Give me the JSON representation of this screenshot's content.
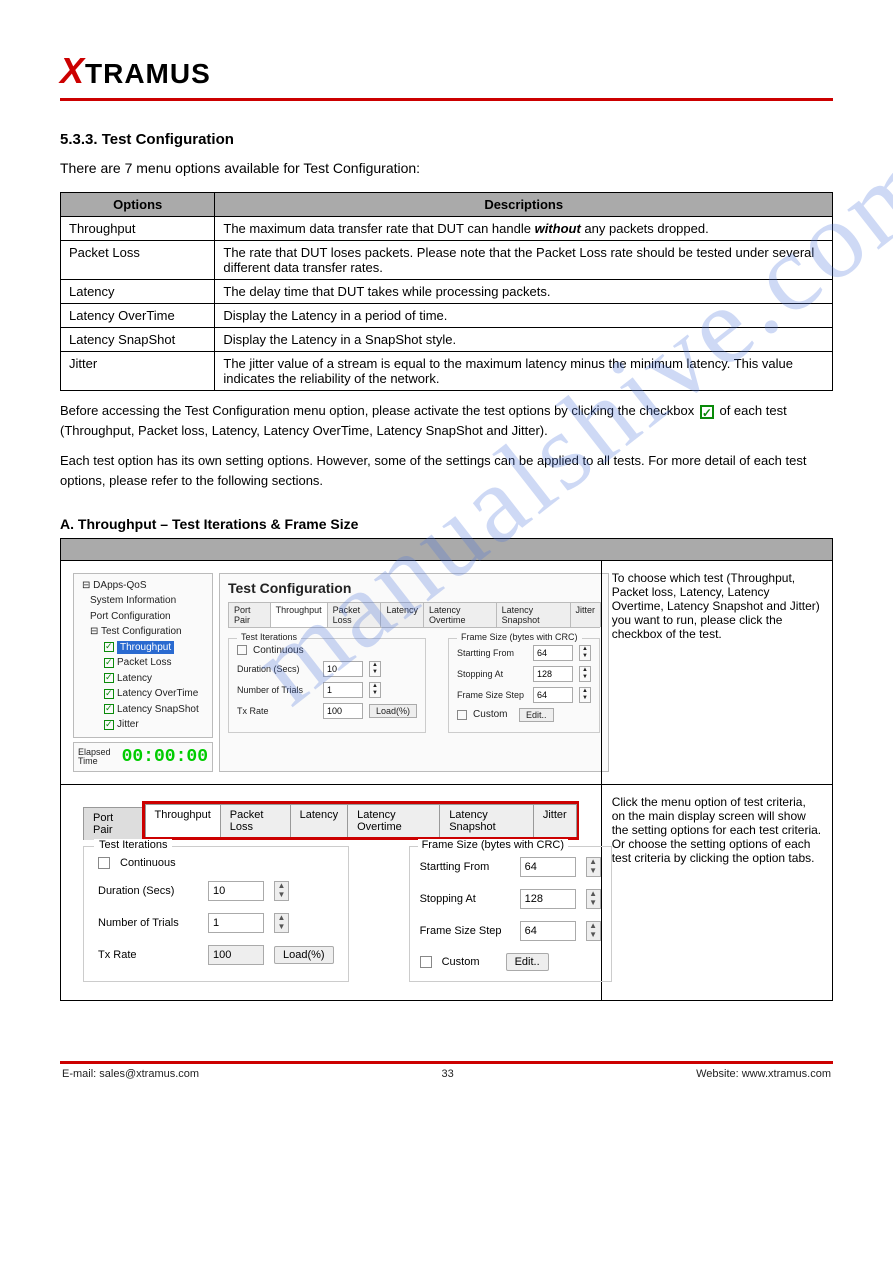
{
  "logo": {
    "x": "X",
    "rest": "TRAMUS"
  },
  "section_heading": "5.3.3. Test Configuration",
  "intro": "There are 7 menu options available for Test Configuration:",
  "def_table": {
    "headers": [
      "Options",
      "Descriptions"
    ],
    "rows": [
      {
        "opt": "Throughput",
        "desc_pre": "The maximum data transfer rate that DUT can handle ",
        "desc_italic": "without",
        "desc_post": " any packets dropped."
      },
      {
        "opt": "Packet Loss",
        "desc": "The rate that DUT loses packets. Please note that the Packet Loss rate should be tested under several different data transfer rates."
      },
      {
        "opt": "Latency",
        "desc": "The delay time that DUT takes while processing packets."
      },
      {
        "opt": "Latency OverTime",
        "desc": "Display the Latency in a period of time."
      },
      {
        "opt": "Latency SnapShot",
        "desc": "Display the Latency in a SnapShot style."
      },
      {
        "opt": "Jitter",
        "desc": "The jitter value of a stream is equal to the maximum latency minus the minimum latency. This value indicates the reliability of the network."
      }
    ]
  },
  "body_para_1_pre": "Before accessing the Test Configuration menu option, please activate the test options by clicking the checkbox ",
  "body_para_1_post": " of each test (Throughput, Packet loss, Latency, Latency OverTime, Latency SnapShot and Jitter).",
  "body_para_2": "Each test option has its own setting options. However, some of the settings can be applied to all tests. For more detail of each test options, please refer to the following sections.",
  "sub_heading": "A. Throughput – Test Iterations & Frame Size",
  "tc_panel": {
    "tree": {
      "root": "DApps-QoS",
      "items": [
        "System Information",
        "Port Configuration",
        "Test Configuration"
      ],
      "tests": [
        "Throughput",
        "Packet Loss",
        "Latency",
        "Latency OverTime",
        "Latency SnapShot",
        "Jitter"
      ],
      "selected": "Throughput"
    },
    "elapsed_label": "Elapsed Time",
    "elapsed_value": "00:00:00",
    "panel_title": "Test Configuration",
    "tabs": [
      "Port Pair",
      "Throughput",
      "Packet Loss",
      "Latency",
      "Latency Overtime",
      "Latency Snapshot",
      "Jitter"
    ],
    "active_tab": "Throughput",
    "test_iterations": {
      "legend": "Test Iterations",
      "continuous": "Continuous",
      "duration_label": "Duration (Secs)",
      "duration_value": "10",
      "trials_label": "Number of Trials",
      "trials_value": "1",
      "txrate_label": "Tx Rate",
      "txrate_value": "100",
      "txrate_unit": "Load(%)"
    },
    "frame_size": {
      "legend": "Frame Size (bytes with CRC)",
      "start_label": "Startting From",
      "start_value": "64",
      "stop_label": "Stopping At",
      "stop_value": "128",
      "step_label": "Frame Size Step",
      "step_value": "64",
      "custom_label": "Custom",
      "edit_btn": "Edit.."
    }
  },
  "row1_desc": "To choose which test (Throughput, Packet loss, Latency, Latency Overtime, Latency Snapshot and Jitter) you want to run, please click the checkbox of the test.",
  "row2_desc": "Click the menu option of test criteria, on the main display screen will show the setting options for each test criteria. Or choose the setting options of each test criteria by clicking the option tabs.",
  "watermark": "manualshive.com",
  "footer_left": "E-mail: sales@xtramus.com",
  "footer_center": "33",
  "footer_right": "Website: www.xtramus.com"
}
